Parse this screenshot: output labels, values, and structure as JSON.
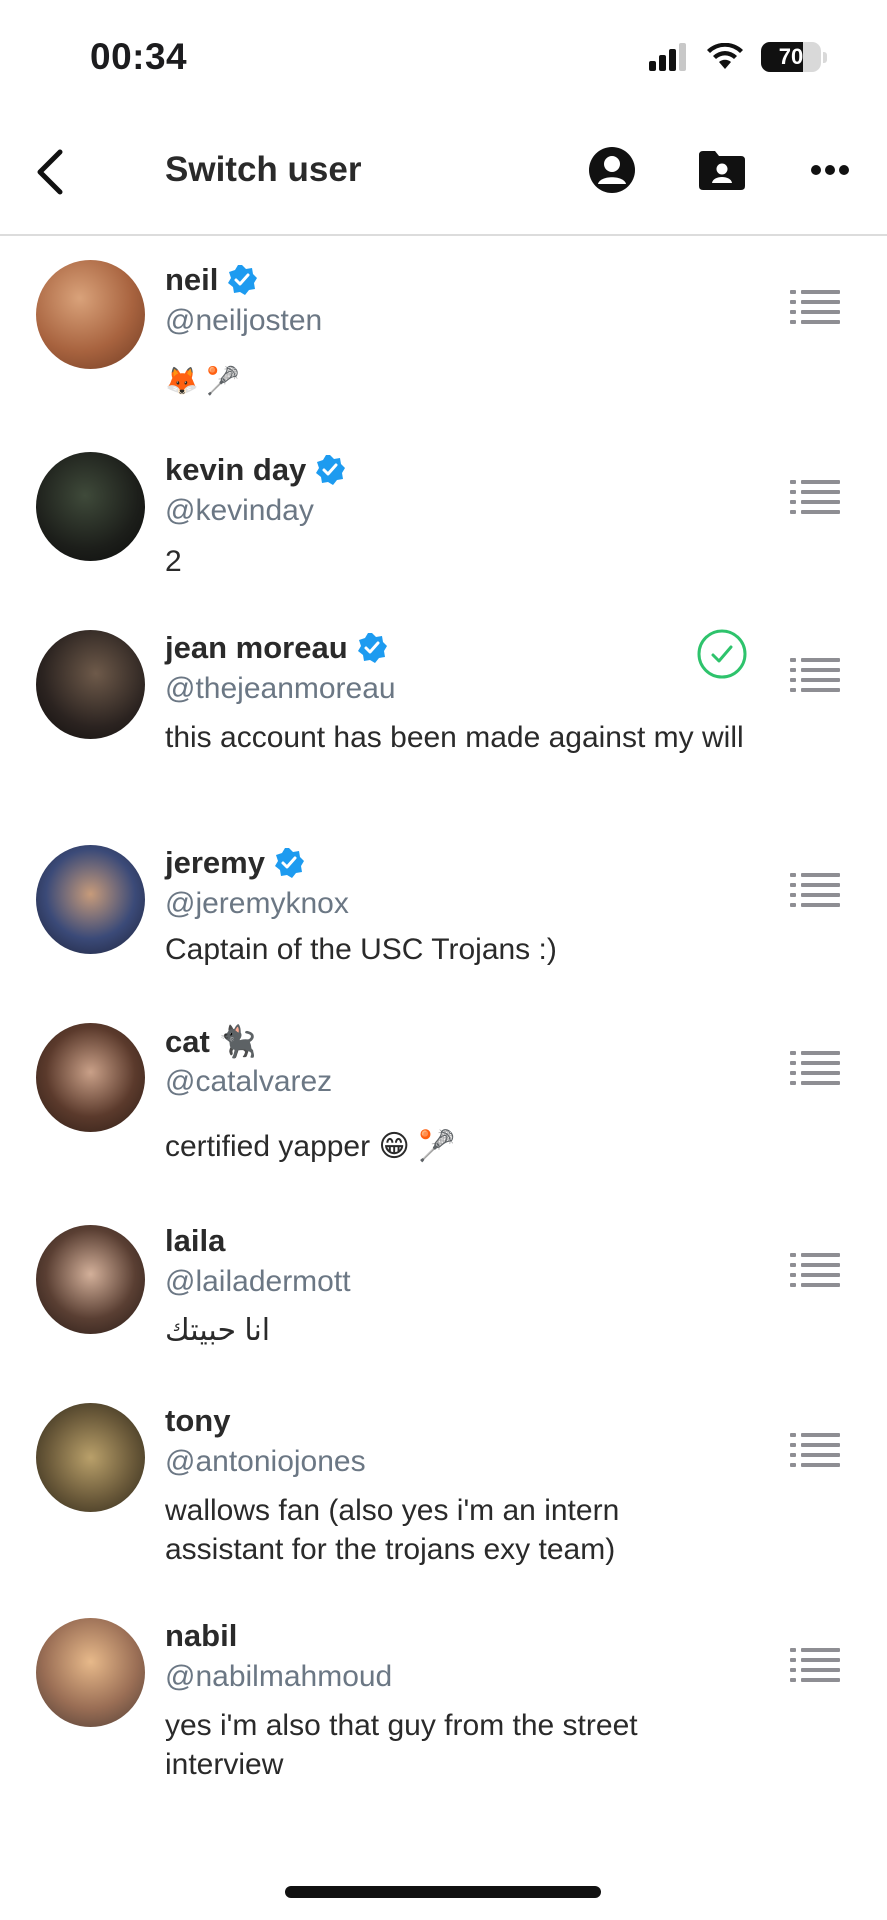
{
  "status_bar": {
    "time": "00:34",
    "battery": "70",
    "battery_level": 0.7
  },
  "header": {
    "title": "Switch user"
  },
  "accounts": [
    {
      "name": "neil",
      "verified": true,
      "handle": "@neiljosten",
      "bio": "🦊 🥍",
      "active": false
    },
    {
      "name": "kevin day",
      "verified": true,
      "handle": "@kevinday",
      "bio": "2",
      "active": false
    },
    {
      "name": "jean moreau",
      "verified": true,
      "handle": "@thejeanmoreau",
      "bio": "this account has been made against my will",
      "active": true
    },
    {
      "name": "jeremy",
      "verified": true,
      "handle": "@jeremyknox",
      "bio": "Captain of the USC Trojans :)",
      "active": false
    },
    {
      "name": "cat 🐈‍⬛",
      "verified": false,
      "handle": "@catalvarez",
      "bio": "certified yapper 😁 🥍",
      "active": false
    },
    {
      "name": "laila",
      "verified": false,
      "handle": "@lailadermott",
      "bio": "انا حبيتك",
      "active": false
    },
    {
      "name": "tony",
      "verified": false,
      "handle": "@antoniojones",
      "bio": "wallows fan (also yes i'm an intern assistant for the trojans exy team)",
      "active": false
    },
    {
      "name": "nabil",
      "verified": false,
      "handle": "@nabilmahmoud",
      "bio": "yes i'm also that guy from the street interview",
      "active": false
    }
  ],
  "colors": {
    "verified": "#1d9bf0",
    "active_check": "#2ec36c",
    "handle": "#6b7784"
  }
}
